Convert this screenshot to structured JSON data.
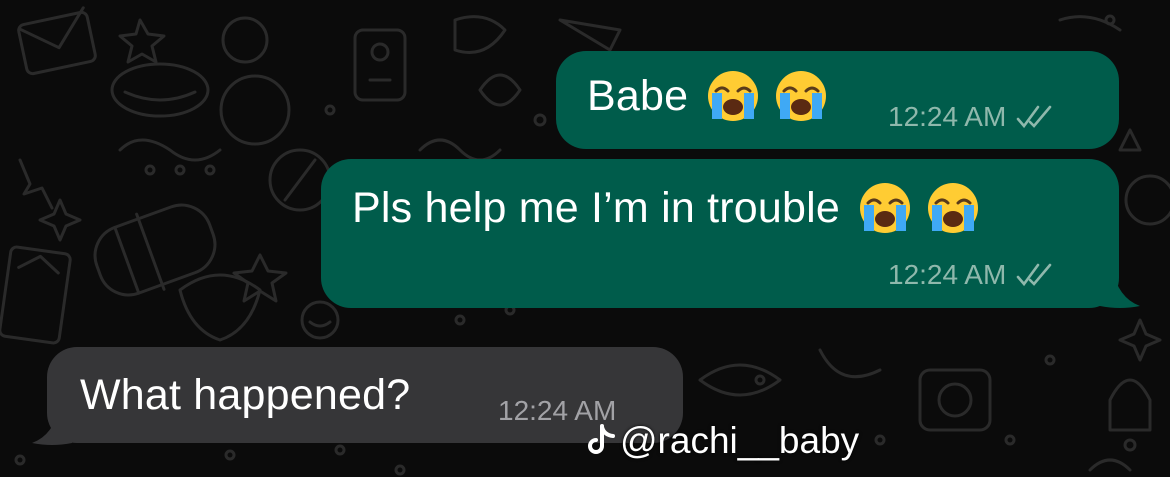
{
  "colors": {
    "background": "#0b0b0b",
    "outgoing_bubble": "#005c4b",
    "incoming_bubble": "#363638"
  },
  "messages": [
    {
      "direction": "outgoing",
      "text": "Babe",
      "emoji": [
        "loudly-crying-face",
        "loudly-crying-face"
      ],
      "time": "12:24 AM",
      "status": "read-double-check"
    },
    {
      "direction": "outgoing",
      "text": "Pls help me I’m in trouble",
      "emoji": [
        "loudly-crying-face",
        "loudly-crying-face"
      ],
      "time": "12:24 AM",
      "status": "read-double-check"
    },
    {
      "direction": "incoming",
      "text": "What happened?",
      "time": "12:24 AM"
    }
  ],
  "watermark": {
    "icon": "tiktok-icon",
    "handle": "@rachi__baby"
  }
}
